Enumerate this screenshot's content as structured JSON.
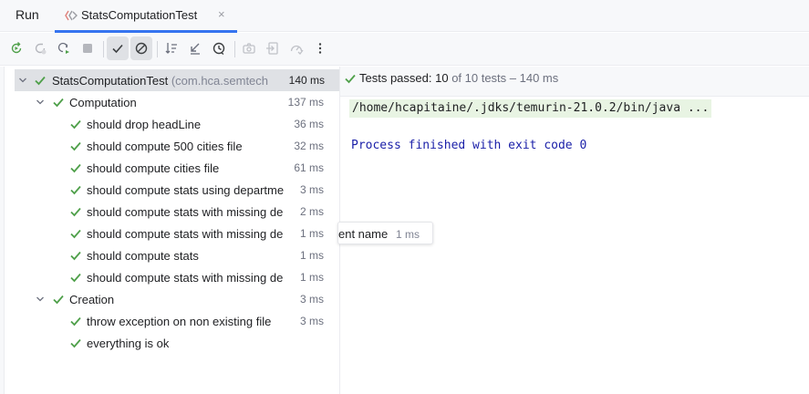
{
  "header": {
    "run_label": "Run",
    "tab_title": "StatsComputationTest",
    "close_glyph": "×"
  },
  "toolbar": {
    "buttons": [
      {
        "name": "rerun-icon"
      },
      {
        "name": "rerun-failed-icon"
      },
      {
        "name": "toggle-auto-test-icon"
      },
      {
        "name": "stop-icon"
      },
      {
        "name": "show-passed-icon",
        "active": true
      },
      {
        "name": "show-ignored-icon",
        "active": true
      },
      {
        "name": "sort-alphabetically-icon"
      },
      {
        "name": "sort-by-duration-icon"
      },
      {
        "name": "history-icon"
      },
      {
        "name": "screenshot-icon"
      },
      {
        "name": "import-tests-icon"
      },
      {
        "name": "coverage-icon"
      },
      {
        "name": "more-options-icon"
      }
    ]
  },
  "tree": {
    "root": {
      "label": "StatsComputationTest",
      "package": "(com.hca.semtech",
      "duration": "140 ms"
    },
    "items": [
      {
        "label": "Computation",
        "duration": "137 ms"
      },
      {
        "label": "should drop headLine",
        "duration": "36 ms"
      },
      {
        "label": "should compute 500 cities file",
        "duration": "32 ms"
      },
      {
        "label": "should compute cities file",
        "duration": "61 ms"
      },
      {
        "label": "should compute stats using departme",
        "duration": "3 ms"
      },
      {
        "label": "should compute stats with missing de",
        "duration": "2 ms"
      },
      {
        "label": "should compute stats with missing de",
        "duration": "1 ms"
      },
      {
        "label": "should compute stats",
        "duration": "1 ms"
      },
      {
        "label": "should compute stats with missing de",
        "duration": "1 ms"
      },
      {
        "label": "Creation",
        "duration": "3 ms"
      },
      {
        "label": "throw exception on non existing file",
        "duration": "3 ms"
      },
      {
        "label": "everything is ok",
        "duration": ""
      }
    ]
  },
  "tooltip": {
    "text": "ent name",
    "duration": "1 ms"
  },
  "status": {
    "prefix": "Tests passed: ",
    "passed": "10",
    "total": " of 10 tests",
    "duration": " – 140 ms"
  },
  "console": {
    "command": "/home/hcapitaine/.jdks/temurin-21.0.2/bin/java ...",
    "exit_line": "Process finished with exit code 0"
  },
  "colors": {
    "pass_green": "#4fa04a",
    "accent_blue": "#3574f0",
    "exit_text": "#1a1fa8"
  }
}
